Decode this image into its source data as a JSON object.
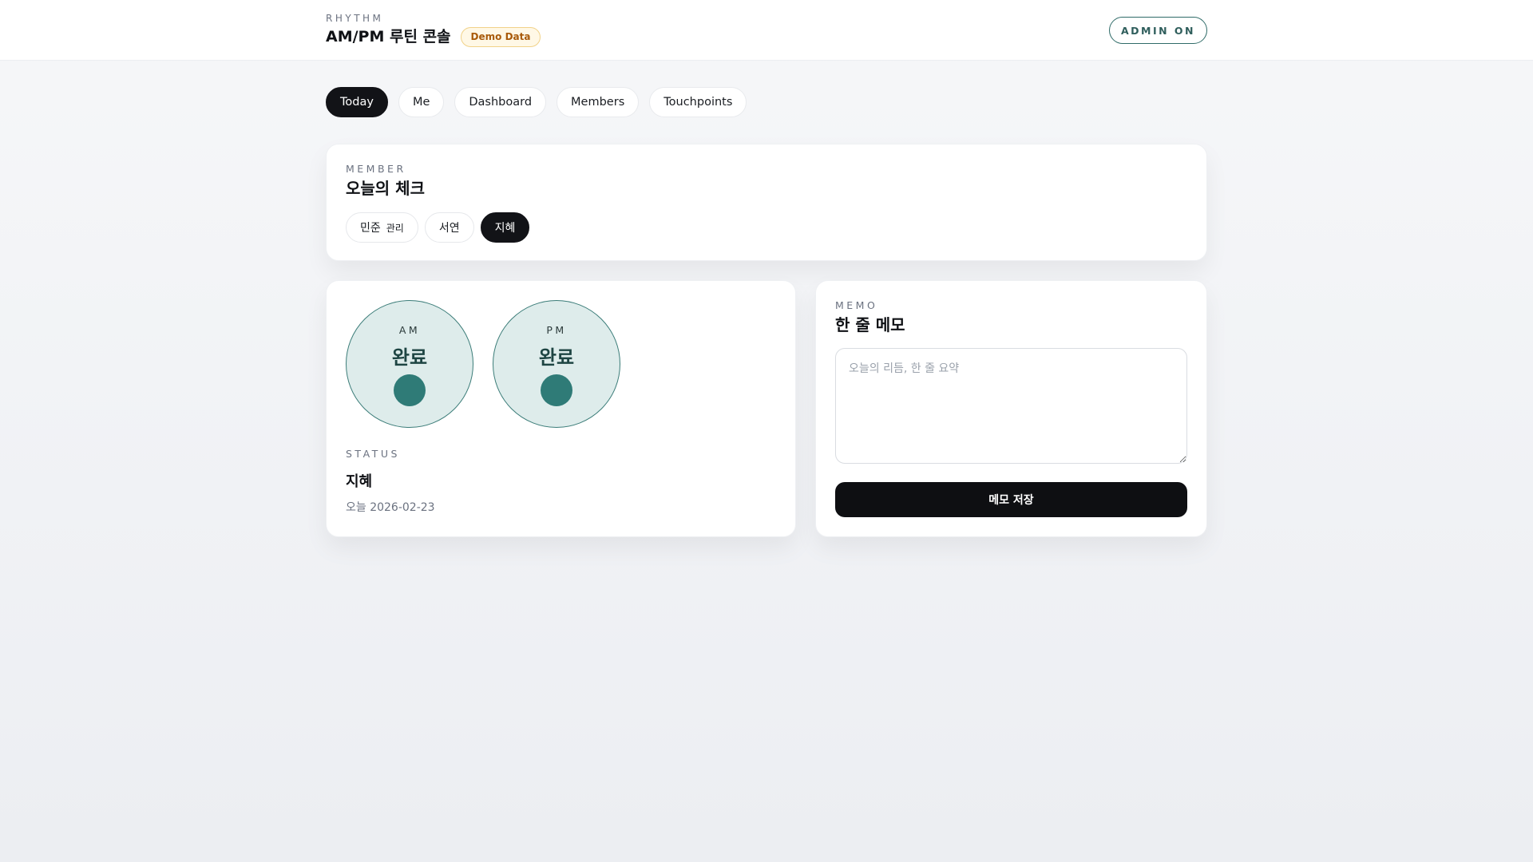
{
  "header": {
    "eyebrow": "RHYTHM",
    "title": "AM/PM 루틴 콘솔",
    "badge": "Demo Data",
    "admin_label": "ADMIN ON"
  },
  "tabs": [
    {
      "label": "Today",
      "active": true
    },
    {
      "label": "Me",
      "active": false
    },
    {
      "label": "Dashboard",
      "active": false
    },
    {
      "label": "Members",
      "active": false
    },
    {
      "label": "Touchpoints",
      "active": false
    }
  ],
  "member": {
    "eyebrow": "MEMBER",
    "title": "오늘의 체크",
    "chips": [
      {
        "label": "민준",
        "sub": "관리",
        "active": false
      },
      {
        "label": "서연",
        "sub": "",
        "active": false
      },
      {
        "label": "지혜",
        "sub": "",
        "active": true
      }
    ]
  },
  "checks": [
    {
      "label": "AM",
      "value": "완료"
    },
    {
      "label": "PM",
      "value": "완료"
    }
  ],
  "status": {
    "eyebrow": "STATUS",
    "name": "지혜",
    "date": "오늘 2026-02-23"
  },
  "memo": {
    "eyebrow": "MEMO",
    "title": "한 줄 메모",
    "placeholder": "오늘의 리듬, 한 줄 요약",
    "value": "",
    "save_label": "메모 저장"
  },
  "colors": {
    "accent": "#2f7b77",
    "primary_dark": "#121317",
    "badge_text": "#a85a0a"
  }
}
